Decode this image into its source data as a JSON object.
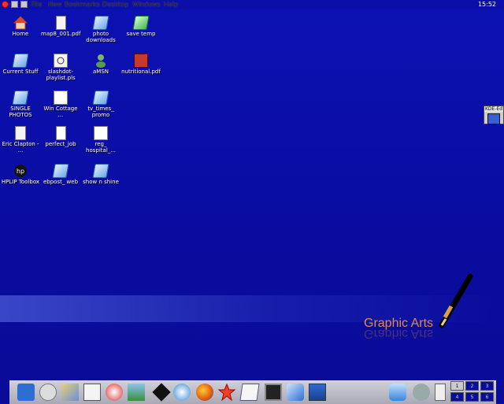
{
  "menubar": {
    "menus": [
      "File",
      "New",
      "Bookmarks",
      "Desktop",
      "Windows",
      "Help"
    ],
    "clock": "15:52"
  },
  "desktop_icons": [
    {
      "label": "Home",
      "icon": "home-icon"
    },
    {
      "label": "map8_001.pdf",
      "icon": "pdf-icon"
    },
    {
      "label": "photo downloads",
      "icon": "folder-icon"
    },
    {
      "label": "save temp",
      "icon": "folder-icon"
    },
    {
      "label": "Current Stuff",
      "icon": "folder-icon"
    },
    {
      "label": "slashdot-playlist.pls",
      "icon": "audio-file-icon"
    },
    {
      "label": "aMSN",
      "icon": "amsn-icon"
    },
    {
      "label": "nutritional.pdf",
      "icon": "pdf-icon"
    },
    {
      "label": "SINGLE PHOTOS",
      "icon": "folder-icon"
    },
    {
      "label": "Win Cottage ...",
      "icon": "image-file-icon"
    },
    {
      "label": "tv_times_ promo",
      "icon": "folder-icon"
    },
    {
      "label": "Eric Clapton - ...",
      "icon": "audio-file-icon"
    },
    {
      "label": "perfect_job",
      "icon": "text-file-icon"
    },
    {
      "label": "reg_ hospital_...",
      "icon": "image-file-icon"
    },
    {
      "label": "HPLIP Toolbox",
      "icon": "hp-icon"
    },
    {
      "label": "ebpost_ web",
      "icon": "folder-icon"
    },
    {
      "label": "show n shine",
      "icon": "folder-icon"
    }
  ],
  "wallpaper": {
    "text": "Graphic Arts"
  },
  "widget": {
    "title": "KDE-Ed"
  },
  "panel": {
    "launchers": [
      "kde-menu-icon",
      "media-icon",
      "cleaner-icon",
      "notes-icon",
      "help-icon",
      "image-viewer-icon",
      "inkscape-icon",
      "kcontrol-icon",
      "firefox-icon",
      "star-icon",
      "office-icon",
      "terminal-icon",
      "network-icon",
      "monitor-icon"
    ],
    "tray": [
      "klipper-icon",
      "kmix-icon",
      "clipboard-icon"
    ],
    "desktops": [
      "1",
      "2",
      "3",
      "4",
      "5",
      "6"
    ]
  }
}
